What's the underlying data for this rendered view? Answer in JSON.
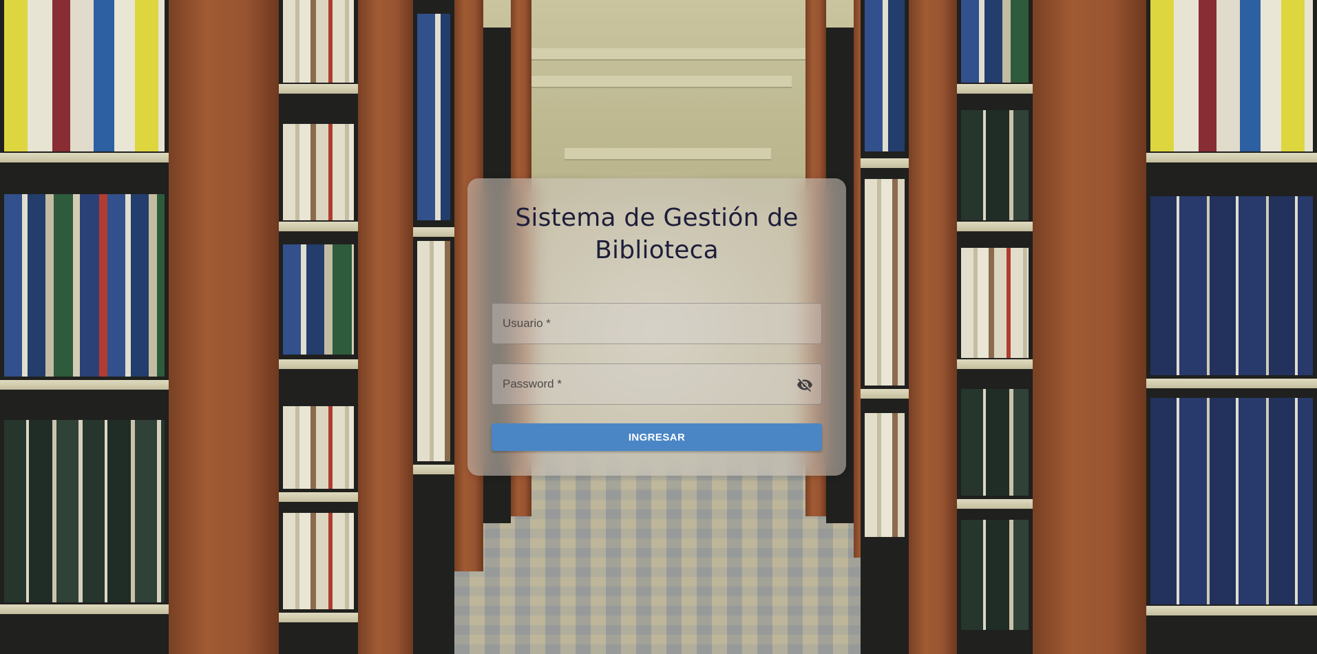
{
  "login": {
    "title": "Sistema de Gestión de Biblioteca",
    "username_label": "Usuario *",
    "password_label": "Password *",
    "password_toggle_icon": "eye-off-icon",
    "submit_label": "INGRESAR"
  },
  "colors": {
    "primary_button": "#4a86c5",
    "title_text": "#1e1e3a"
  }
}
